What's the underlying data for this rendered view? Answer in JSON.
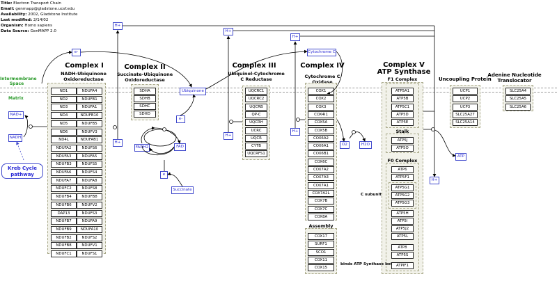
{
  "header": {
    "title_label": "Title:",
    "title": "Electron Transport Chain",
    "email_label": "Email:",
    "email": "genmapp@gladstone.ucsf.edu",
    "availability_label": "Availability:",
    "availability": "2002, Gladstone Institute",
    "modified_label": "Last modified:",
    "modified": "2/14/02",
    "organism_label": "Organism:",
    "organism": "Homo sapiens",
    "source_label": "Data Source:",
    "source": "GenMAPP 2.0"
  },
  "regions": {
    "intermembrane": "Intermembrane Space",
    "matrix": "Matrix"
  },
  "complex1": {
    "title": "Complex I",
    "subtitle": "NADH-Ubiquinone Oxidoreductase",
    "genes": [
      "ND1",
      "NDUFA4",
      "ND2",
      "NDUFB1",
      "ND3",
      "NDUFA1",
      "ND4",
      "NDUFB10",
      "ND5",
      "NDUFB5",
      "ND6",
      "NDUFV3",
      "ND4L",
      "NDUFAB1",
      "NDUFA2",
      "NDUFS6",
      "NDUFA3",
      "NDUFA5",
      "NDUFB3",
      "NDUFS5",
      "NDUFA6",
      "NDUFS4",
      "NDUFA7",
      "NDUFA8",
      "NDUFC2",
      "NDUFS8",
      "NDUFB4",
      "NDUFB8",
      "NDUFB6",
      "NDUFV2",
      "DAP13",
      "NDUFS3",
      "NDUFB7",
      "NDUFA9",
      "NDUFB9",
      "NDUFA10",
      "NDUFB2",
      "NDUFS2",
      "NDUFB8",
      "NDUFV1",
      "NDUFC1",
      "NDUFS1"
    ]
  },
  "complex2": {
    "title": "Complex II",
    "subtitle": "Succinate-Ubiquinone Oxidoreductase",
    "genes": [
      "SDHA",
      "SDHB",
      "SDHC",
      "SDHD"
    ]
  },
  "complex3": {
    "title": "Complex III",
    "subtitle": "Ubiquinol-Cytochrome C Reductase",
    "genes": [
      "UQCRC1",
      "UQCRC2",
      "UQCRB",
      "QP-C",
      "UQCRH",
      "UCRC",
      "UQCR",
      "CYTB",
      "UQCRFS1"
    ]
  },
  "complex4": {
    "title": "Complex IV",
    "subtitle": "Cytochrome C Oxidase",
    "genes": [
      "COX1",
      "COX2",
      "COX3",
      "COX4I1",
      "COX5A",
      "COX5B",
      "COX6A2",
      "COX6A1",
      "COX6B1",
      "COX6C",
      "COX7A2",
      "COX7A3",
      "COX7A1",
      "COX7A2L",
      "COX7B",
      "COX7C",
      "COX8A"
    ],
    "assembly_title": "Assembly",
    "assembly": [
      "COX17",
      "SURF1",
      "SCO1",
      "COX11",
      "COX15"
    ]
  },
  "complex5": {
    "title": "Complex V",
    "subtitle": "ATP Synthase",
    "f1_title": "F1 Complex",
    "f1": [
      "ATP5A1",
      "ATP5B",
      "ATP5C1",
      "ATP5D",
      "ATP5E"
    ],
    "stalk_title": "Stalk",
    "stalk": [
      "ATP5J",
      "ATP5O"
    ],
    "f0_title": "F0 Complex",
    "f0a": [
      "ATP6",
      "ATP5F1"
    ],
    "c_subunit_label": "C subunit",
    "c_subunit": [
      "ATP5G1",
      "ATP5G2",
      "ATP5G3"
    ],
    "f0b": [
      "ATP5H",
      "ATP5I",
      "ATP5J2",
      "ATP5L"
    ],
    "f0c": [
      "ATP8",
      "ATP5S"
    ],
    "f0d": [
      "ATPIF1"
    ],
    "binds_note": "binds ATP Synthase beta"
  },
  "uncoupling": {
    "title": "Uncoupling Protein",
    "genes": [
      "UCP1",
      "UCP2",
      "UCP3",
      "SLC25A27",
      "SLC25A14"
    ]
  },
  "ant": {
    "title": "Adenine Nucleotide Translocator",
    "genes": [
      "SLC25A4",
      "SLC25A5",
      "SLC25A6"
    ]
  },
  "metabolites": {
    "hplus": "H+",
    "e": "e-",
    "e_plain": "e",
    "nadplus": "NAD+",
    "nadh": "NADH",
    "ubiquinone": "Ubiquinone",
    "cytochrome_c": "Cytochrome C",
    "fadh2": "FADH2",
    "fad": "FAD",
    "succinate": "Succinate",
    "o2": "O2",
    "h2o": "H2O",
    "atp": "ATP"
  },
  "krebs": "Kreb Cycle pathway"
}
